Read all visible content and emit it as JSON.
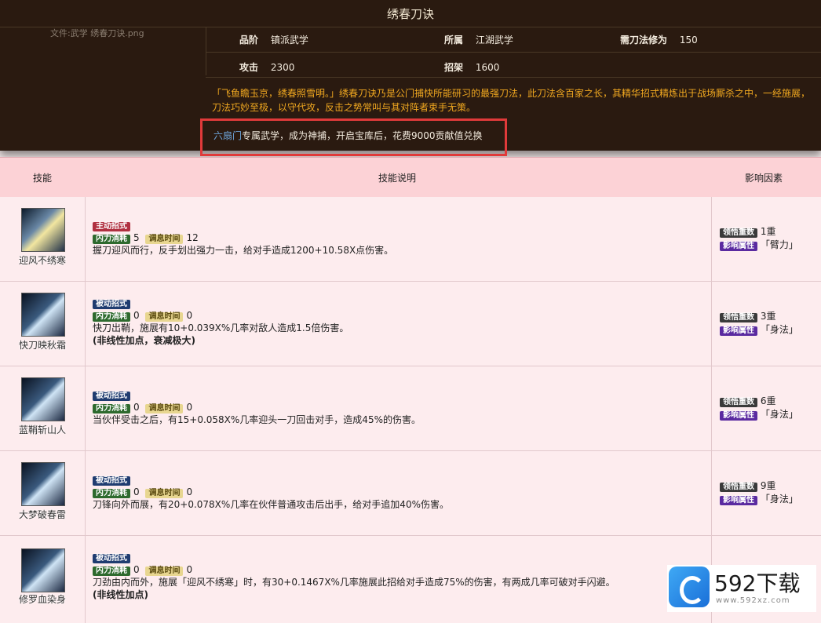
{
  "header": {
    "title": "绣春刀诀",
    "image_filename": "文件:武学 绣春刀诀.png",
    "grade_label": "品阶",
    "grade_value": "镇派武学",
    "belong_label": "所属",
    "belong_value": "江湖武学",
    "req_label": "需刀法修为",
    "req_value": "150",
    "attack_label": "攻击",
    "attack_value": "2300",
    "parry_label": "招架",
    "parry_value": "1600",
    "description": "「飞鱼瞻玉京，绣春照雪明。」绣春刀诀乃是公门捕快所能研习的最强刀法，此刀法含百家之长，其精华招式精炼出于战场厮杀之中，一经施展，刀法巧妙至极，以守代攻，反击之势常叫与其对阵者束手无策。",
    "note_highlight": "六扇门",
    "note_rest": "专属武学，成为神捕，开启宝库后，花费9000贡献值兑换"
  },
  "table": {
    "col_skill": "技能",
    "col_desc": "技能说明",
    "col_factor": "影响因素",
    "rows": [
      {
        "name": "迎风不绣寒",
        "type": "主动招式",
        "cost_label": "内力消耗",
        "cost": "5",
        "cd_label": "调息时间",
        "cd": "12",
        "desc": "握刀迎风而行，反手划出强力一击，给对手造成1200+10.58X点伤害。",
        "extra": "",
        "layer_label": "领悟重数",
        "layer": "1重",
        "attr_label": "影响属性",
        "attr": "「臂力」"
      },
      {
        "name": "快刀映秋霜",
        "type": "被动招式",
        "cost_label": "内力消耗",
        "cost": "0",
        "cd_label": "调息时间",
        "cd": "0",
        "desc": "快刀出鞘，施展有10+0.039X%几率对敌人造成1.5倍伤害。",
        "extra": "(非线性加点，衰减极大)",
        "layer_label": "领悟重数",
        "layer": "3重",
        "attr_label": "影响属性",
        "attr": "「身法」"
      },
      {
        "name": "蓝鞘斩山人",
        "type": "被动招式",
        "cost_label": "内力消耗",
        "cost": "0",
        "cd_label": "调息时间",
        "cd": "0",
        "desc": "当伙伴受击之后，有15+0.058X%几率迎头一刀回击对手，造成45%的伤害。",
        "extra": "",
        "layer_label": "领悟重数",
        "layer": "6重",
        "attr_label": "影响属性",
        "attr": "「身法」"
      },
      {
        "name": "大梦破春雷",
        "type": "被动招式",
        "cost_label": "内力消耗",
        "cost": "0",
        "cd_label": "调息时间",
        "cd": "0",
        "desc": "刀锋向外而展，有20+0.078X%几率在伙伴普通攻击后出手，给对手追加40%伤害。",
        "extra": "",
        "layer_label": "领悟重数",
        "layer": "9重",
        "attr_label": "影响属性",
        "attr": "「身法」"
      },
      {
        "name": "修罗血染身",
        "type": "被动招式",
        "cost_label": "内力消耗",
        "cost": "0",
        "cd_label": "调息时间",
        "cd": "0",
        "desc": "刀劲由内而外，施展「迎风不绣寒」时，有30+0.1467X%几率施展此招给对手造成75%的伤害，有两成几率可破对手闪避。",
        "extra": "(非线性加点)",
        "layer_label": "",
        "layer": "",
        "attr_label": "",
        "attr": ""
      }
    ]
  },
  "watermark": {
    "brand": "592下载",
    "url": "www.592xz.com"
  },
  "colors": {
    "header_bg": "#2a1a10",
    "desc_text": "#f0a820",
    "highlight_box": "#e03a3a",
    "table_head": "#fcd2d6",
    "row_bg": "#fdecee"
  }
}
